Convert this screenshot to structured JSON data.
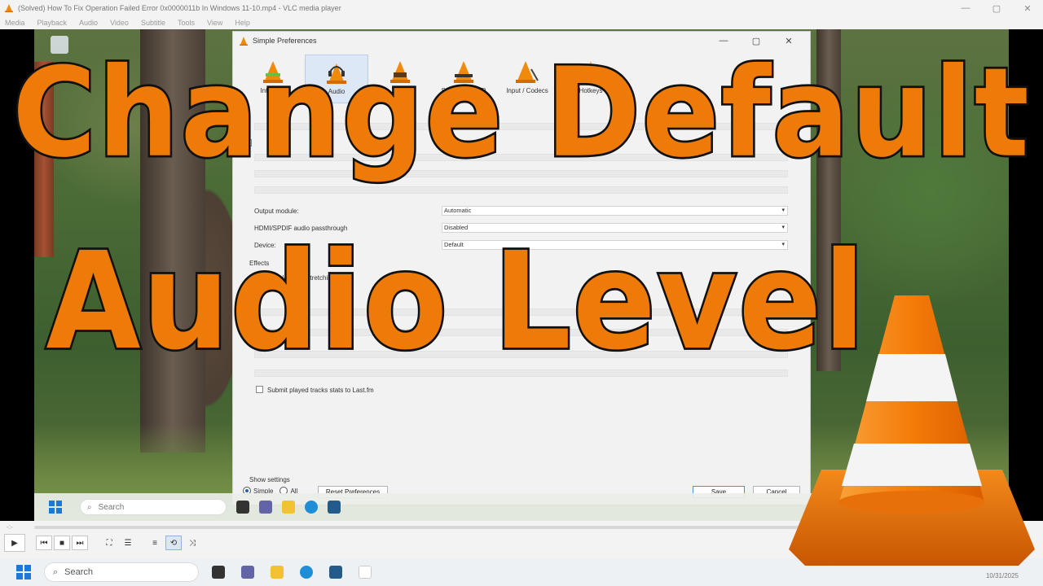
{
  "vlc_window": {
    "title": "(Solved) How To Fix Operation Failed Error 0x0000011b In Windows 11-10.mp4 - VLC media player",
    "menu": [
      "Media",
      "Playback",
      "Audio",
      "Video",
      "Subtitle",
      "Tools",
      "View",
      "Help"
    ],
    "controls": {
      "minimize": "—",
      "maximize": "▢",
      "close": "✕"
    }
  },
  "dialog": {
    "title": "Simple Preferences",
    "tabs": [
      {
        "label": "Interface",
        "icon": "interface-cone-icon"
      },
      {
        "label": "Audio",
        "icon": "audio-headphones-cone-icon",
        "active": true
      },
      {
        "label": "Video",
        "icon": "video-cone-icon"
      },
      {
        "label": "Subtitles / OSD",
        "icon": "subtitles-cone-icon"
      },
      {
        "label": "Input / Codecs",
        "icon": "codecs-cone-icon"
      },
      {
        "label": "Hotkeys",
        "icon": "hotkeys-cone-icon"
      }
    ],
    "output_module_label": "Output module:",
    "output_module_value": "Automatic",
    "passthrough_label": "HDMI/SPDIF audio passthrough",
    "passthrough_value": "Disabled",
    "device_label": "Device:",
    "device_value": "Default",
    "effects_label": "Effects",
    "time_stretch_label": "Enable Time-Stretching audio",
    "submit_label": "Submit played tracks stats to Last.fm",
    "show_settings_label": "Show settings",
    "simple_label": "Simple",
    "all_label": "All",
    "reset_label": "Reset Preferences",
    "save_label": "Save",
    "cancel_label": "Cancel"
  },
  "inner_taskbar": {
    "search_placeholder": "Search"
  },
  "taskbar": {
    "search_placeholder": "Search",
    "date": "10/31/2025"
  },
  "overlay": {
    "line1": "Change Default",
    "line2": "Audio Level"
  },
  "colors": {
    "accent_orange": "#ee7a07",
    "outline": "#111111",
    "cone_white": "#f4f4f4"
  }
}
